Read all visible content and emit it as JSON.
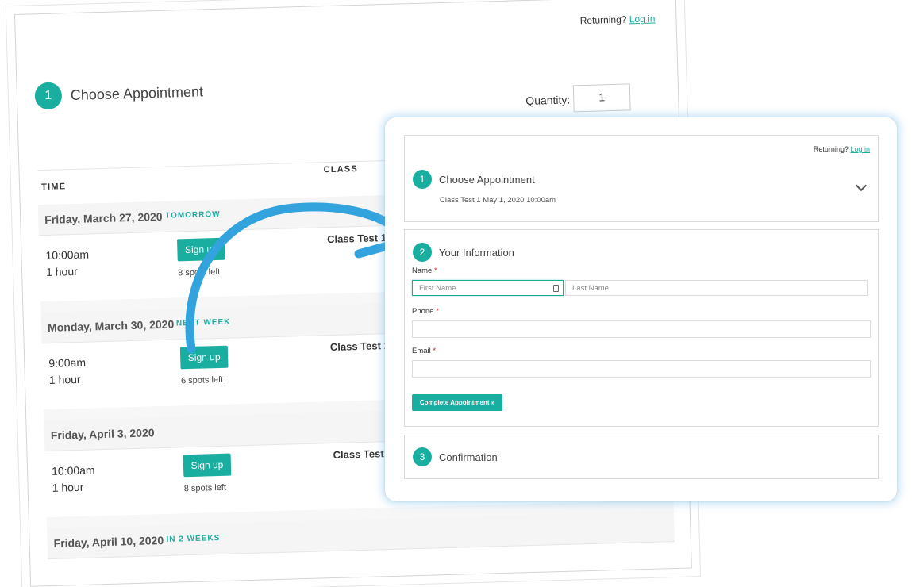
{
  "back": {
    "returning_text": "Returning?",
    "login_link": "Log in",
    "step_number": "1",
    "step_title": "Choose Appointment",
    "quantity_label": "Quantity:",
    "quantity_value": "1",
    "col_time": "TIME",
    "col_class": "CLASS",
    "days": [
      {
        "date": "Friday, March 27, 2020",
        "tag": "TOMORROW",
        "time": "10:00am",
        "duration": "1 hour",
        "signup": "Sign up",
        "spots": "8 spots left",
        "class": "Class Test 1"
      },
      {
        "date": "Monday, March 30, 2020",
        "tag": "NEXT WEEK",
        "time": "9:00am",
        "duration": "1 hour",
        "signup": "Sign up",
        "spots": "6 spots left",
        "class": "Class Test 1"
      },
      {
        "date": "Friday, April 3, 2020",
        "tag": "",
        "time": "10:00am",
        "duration": "1 hour",
        "signup": "Sign up",
        "spots": "8 spots left",
        "class": "Class Test 1"
      },
      {
        "date": "Friday, April 10, 2020",
        "tag": "IN 2 WEEKS"
      }
    ]
  },
  "front": {
    "returning_text": "Returning?",
    "login_link": "Log in",
    "step1": {
      "number": "1",
      "title": "Choose Appointment",
      "summary": "Class Test 1 May 1, 2020 10:00am"
    },
    "step2": {
      "number": "2",
      "title": "Your Information",
      "name_label": "Name",
      "required_mark": "*",
      "first_name_placeholder": "First Name",
      "last_name_placeholder": "Last Name",
      "phone_label": "Phone",
      "email_label": "Email",
      "submit_label": "Complete Appointment »"
    },
    "step3": {
      "number": "3",
      "title": "Confirmation"
    }
  },
  "colors": {
    "accent": "#1aaea0",
    "arrow": "#33a3de",
    "required": "#dd1111"
  },
  "icons": [
    "chevron-down-icon",
    "contact-card-icon",
    "curved-arrow-icon"
  ]
}
